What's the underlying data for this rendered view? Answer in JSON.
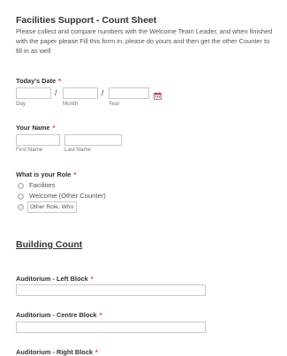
{
  "header": {
    "title": "Facilities Support - Count Sheet",
    "description": "Please collect and compare numbers with the Welcome Team Leader, and when finished with the paper please Fill this form in, please do yours and then get the other Counter to fill in as well"
  },
  "date_field": {
    "label": "Today's Date",
    "required_mark": "*",
    "separator": "/",
    "sublabels": {
      "day": "Day",
      "month": "Month",
      "year": "Year"
    }
  },
  "name_field": {
    "label": "Your Name",
    "required_mark": "*",
    "sublabels": {
      "first": "First Name",
      "last": "Last Name"
    }
  },
  "role_field": {
    "label": "What is your Role",
    "required_mark": "*",
    "options": [
      "Facilities",
      "Welcome (Other Counter)"
    ],
    "other_value": "Other Role, Who"
  },
  "section_title": "Building Count",
  "counts": [
    {
      "label": "Auditorium - Left Block",
      "required_mark": "*"
    },
    {
      "label": "Auditorium - Centre Block",
      "required_mark": "*"
    },
    {
      "label": "Auditorium - Right Block",
      "required_mark": "*"
    }
  ],
  "colors": {
    "required": "#d32f2f",
    "border": "#c9c9c9",
    "text": "#555555",
    "heading": "#333333"
  },
  "icons": {
    "calendar": "calendar-icon"
  }
}
